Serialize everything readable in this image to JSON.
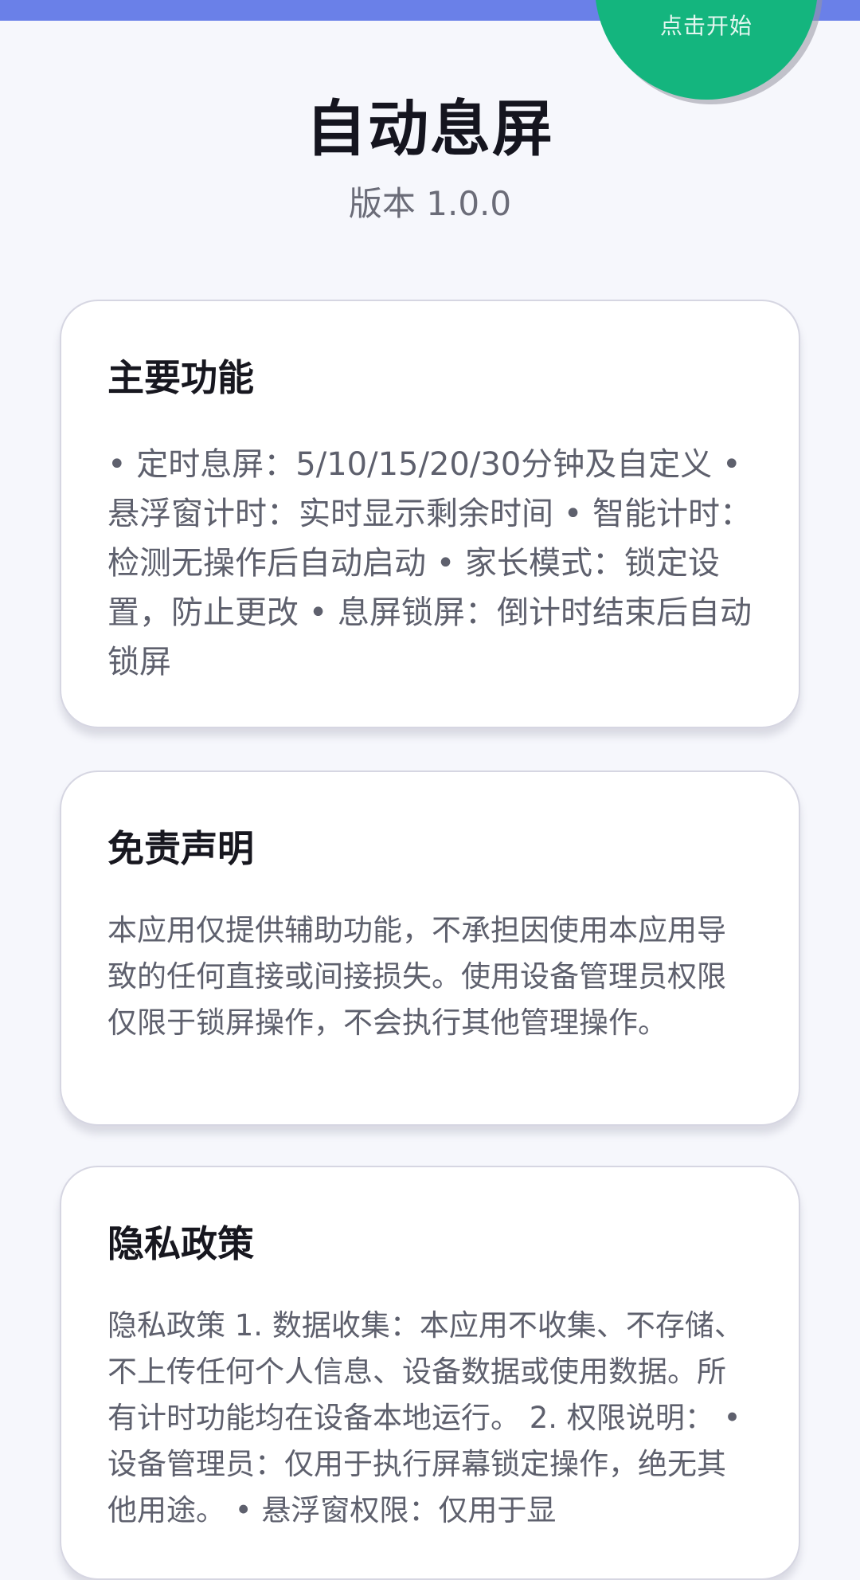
{
  "top_bar": {
    "color": "#6a80e8"
  },
  "start_button": {
    "label": "点击开始",
    "color": "#14b57e"
  },
  "header": {
    "title": "自动息屏",
    "version": "版本 1.0.0"
  },
  "cards": {
    "features": {
      "title": "主要功能",
      "body": "• 定时息屏：5/10/15/20/30分钟及自定义 • 悬浮窗计时：实时显示剩余时间 • 智能计时：检测无操作后自动启动 • 家长模式：锁定设置，防止更改 • 息屏锁屏：倒计时结束后自动锁屏"
    },
    "disclaimer": {
      "title": "免责声明",
      "body": "本应用仅提供辅助功能，不承担因使用本应用导致的任何直接或间接损失。使用设备管理员权限仅限于锁屏操作，不会执行其他管理操作。"
    },
    "privacy": {
      "title": "隐私政策",
      "body": "隐私政策 1. 数据收集：本应用不收集、不存储、不上传任何个人信息、设备数据或使用数据。所有计时功能均在设备本地运行。 2. 权限说明： • 设备管理员：仅用于执行屏幕锁定操作，绝无其他用途。 • 悬浮窗权限：仅用于显"
    }
  }
}
